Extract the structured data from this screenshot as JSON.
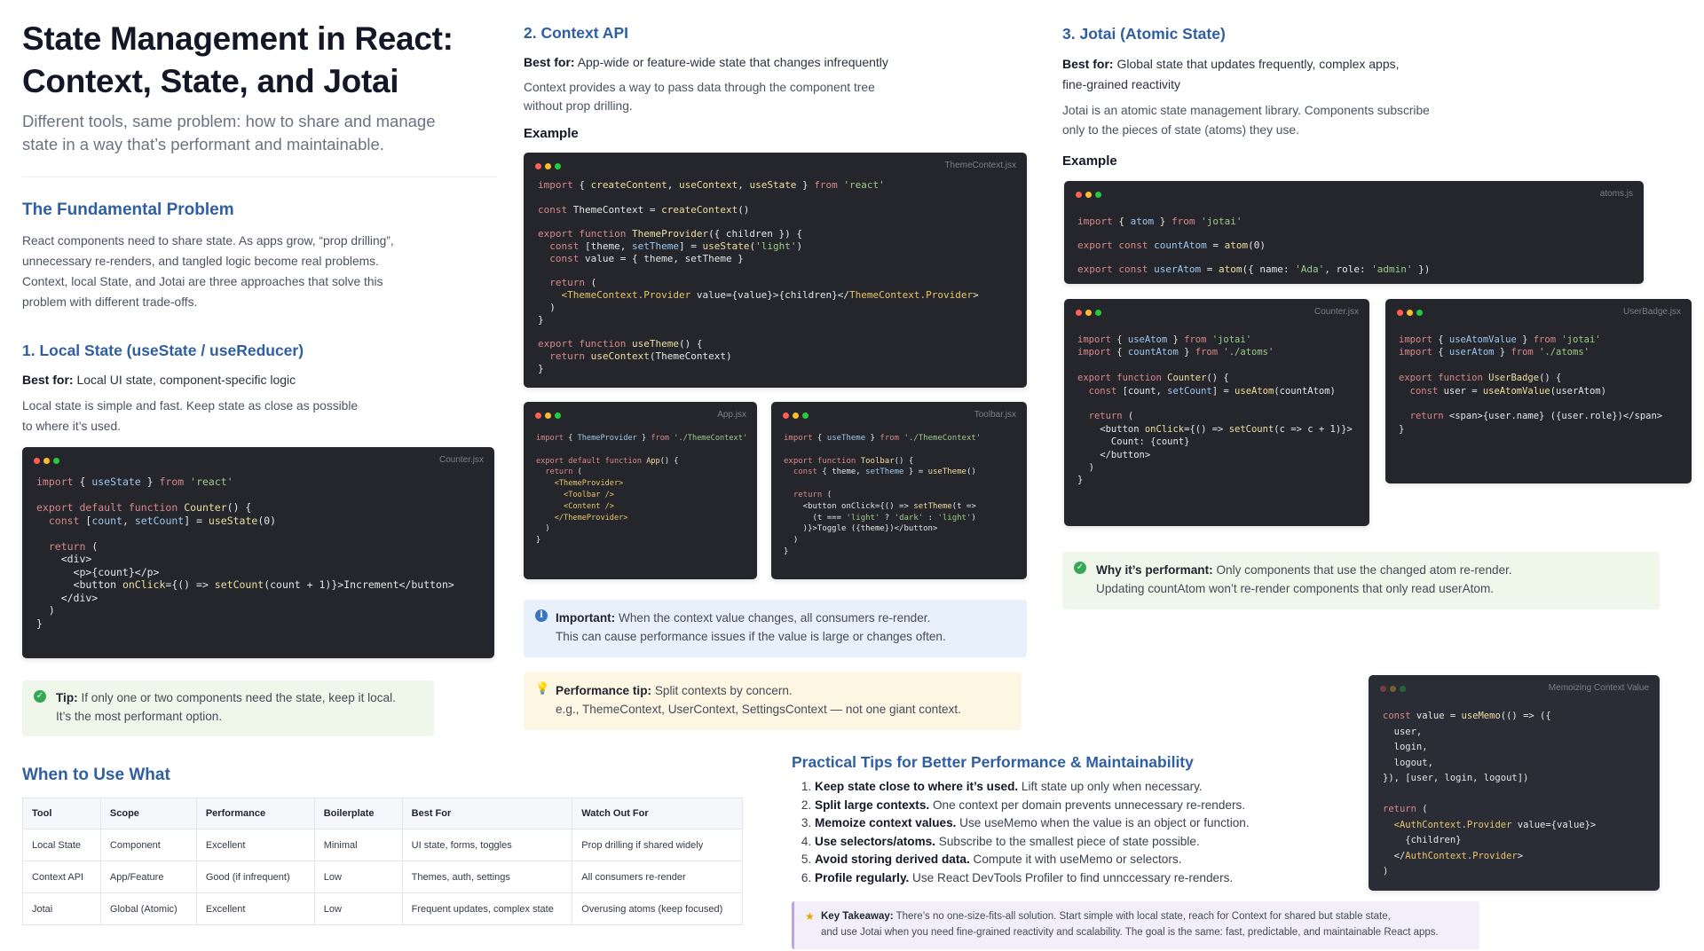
{
  "header": {
    "title_line1": "State Management in React:",
    "title_line2": "Context, State, and Jotai",
    "subtitle_line1": "Different tools, same problem: how to share and manage",
    "subtitle_line2": "state in a way that’s performant and maintainable."
  },
  "fundamental": {
    "heading": "The Fundamental Problem",
    "lines": [
      "React components need to share state. As apps grow, “prop drilling”,",
      "unnecessary re-renders, and tangled logic become real problems.",
      "Context, local State, and Jotai are three approaches that solve this",
      "problem with different trade-offs."
    ]
  },
  "local": {
    "heading": "1. Local State (useState / useReducer)",
    "best_for_label": "Best for:",
    "best_for_text": "Local UI state, component-specific logic",
    "desc_line1": "Local state is simple and fast. Keep state as close as possible",
    "desc_line2": "to where it’s used.",
    "file": "Counter.jsx",
    "tip_label": "Tip:",
    "tip_line1": "If only one or two components need the state, keep it local.",
    "tip_line2": "It’s the most performant option."
  },
  "context": {
    "heading": "2. Context API",
    "best_for_label": "Best for:",
    "best_for_text": "App-wide or feature-wide state that changes infrequently",
    "desc_line1": "Context provides a way to pass data through the component tree",
    "desc_line2": "without prop drilling.",
    "example_label": "Example",
    "file_main": "ThemeContext.jsx",
    "file_app": "App.jsx",
    "file_toolbar": "Toolbar.jsx",
    "important_label": "Important:",
    "important_line1": "When the context value changes, all consumers re-render.",
    "important_line2": "This can cause performance issues if the value is large or changes often.",
    "perf_label": "Performance tip:",
    "perf_line1": "Split contexts by concern.",
    "perf_line2": "e.g., ThemeContext, UserContext, SettingsContext — not one giant context."
  },
  "jotai": {
    "heading": "3. Jotai (Atomic State)",
    "best_for_label": "Best for:",
    "best_for_line1": "Global state that updates frequently, complex apps,",
    "best_for_line2": "fine-grained reactivity",
    "desc_line1": "Jotai is an atomic state management library. Components subscribe",
    "desc_line2": "only to the pieces of state (atoms) they use.",
    "example_label": "Example",
    "file_atoms": "atoms.js",
    "file_counter": "Counter.jsx",
    "file_badge": "UserBadge.jsx",
    "why_label": "Why it’s performant:",
    "why_line1": "Only components that use the changed atom re-render.",
    "why_line2": "Updating countAtom won’t re-render components that only read userAtom."
  },
  "when": {
    "heading": "When to Use What",
    "columns": [
      "Tool",
      "Scope",
      "Performance",
      "Boilerplate",
      "Best For",
      "Watch Out For"
    ],
    "rows": [
      [
        "Local State",
        "Component",
        "Excellent",
        "Minimal",
        "UI state, forms, toggles",
        "Prop drilling if shared widely"
      ],
      [
        "Context API",
        "App/Feature",
        "Good (if infrequent)",
        "Low",
        "Themes, auth, settings",
        "All consumers re-render"
      ],
      [
        "Jotai",
        "Global (Atomic)",
        "Excellent",
        "Low",
        "Frequent updates, complex state",
        "Overusing atoms (keep focused)"
      ]
    ]
  },
  "tips": {
    "heading": "Practical Tips for Better Performance & Maintainability",
    "items": [
      {
        "bold": "Keep state close to where it’s used.",
        "text": " Lift state up only when necessary."
      },
      {
        "bold": "Split large contexts.",
        "text": " One context per domain prevents unnecessary re-renders."
      },
      {
        "bold": "Memoize context values.",
        "text": " Use useMemo when the value is an object or function."
      },
      {
        "bold": "Use selectors/atoms.",
        "text": " Subscribe to the smallest piece of state possible."
      },
      {
        "bold": "Avoid storing derived data.",
        "text": " Compute it with useMemo or selectors."
      },
      {
        "bold": "Profile regularly.",
        "text": " Use React DevTools Profiler to find unnccessary re-renders."
      }
    ],
    "memo_file": "Memoizing Context Value"
  },
  "takeaway": {
    "label": "Key Takeaway:",
    "line1": "There’s no one-size-fits-all solution. Start simple with local state, reach for Context for shared but stable state,",
    "line2": "and use Jotai when you need fine-grained reactivity and scalability. The goal is the same: fast, predictable, and maintainable React apps."
  },
  "colors": {
    "heading_blue": "#2f5fa0",
    "code_bg": "#24262b",
    "tip_green": "#eef7ea",
    "info_blue": "#e8f0fb",
    "warn_yellow": "#fdf6e3",
    "takeaway_purple": "#f2eefa"
  },
  "icons": [
    "check-circle-icon",
    "info-circle-icon",
    "lightbulb-icon",
    "star-icon"
  ]
}
